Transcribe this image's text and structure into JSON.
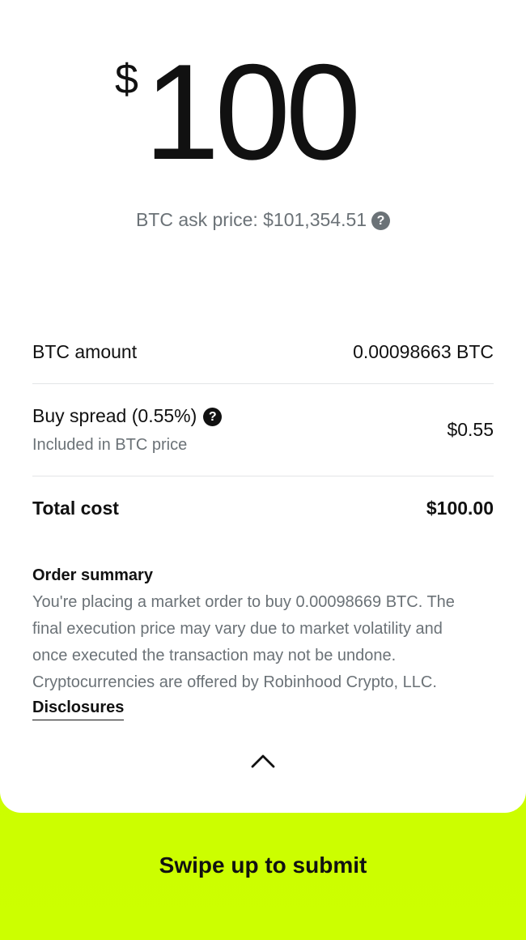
{
  "order": {
    "currency_symbol": "$",
    "amount": "100",
    "ask_price_text": "BTC ask price: $101,354.51",
    "help_glyph": "?"
  },
  "details": {
    "btc_amount_label": "BTC amount",
    "btc_amount_value": "0.00098663 BTC",
    "spread_label": "Buy spread (0.55%)",
    "spread_subtext": "Included in BTC price",
    "spread_value": "$0.55",
    "total_label": "Total cost",
    "total_value": "$100.00"
  },
  "summary": {
    "title": "Order summary",
    "line1": "You're placing a market order to buy 0.00098669 BTC. The",
    "line2": "final execution price may vary due to market volatility and",
    "line3": "once executed the transaction may not be undone.",
    "line4": "Cryptocurrencies are offered by Robinhood Crypto, LLC.",
    "disclosures_link": "Disclosures"
  },
  "icons": {
    "ask_help": "question-circle-icon",
    "spread_help": "question-circle-icon",
    "expand": "chevron-up-icon"
  },
  "colors": {
    "accent_green": "#ccff00",
    "text_primary": "#111111",
    "text_secondary": "#6b7277"
  },
  "footer": {
    "swipe_label": "Swipe up to submit"
  }
}
